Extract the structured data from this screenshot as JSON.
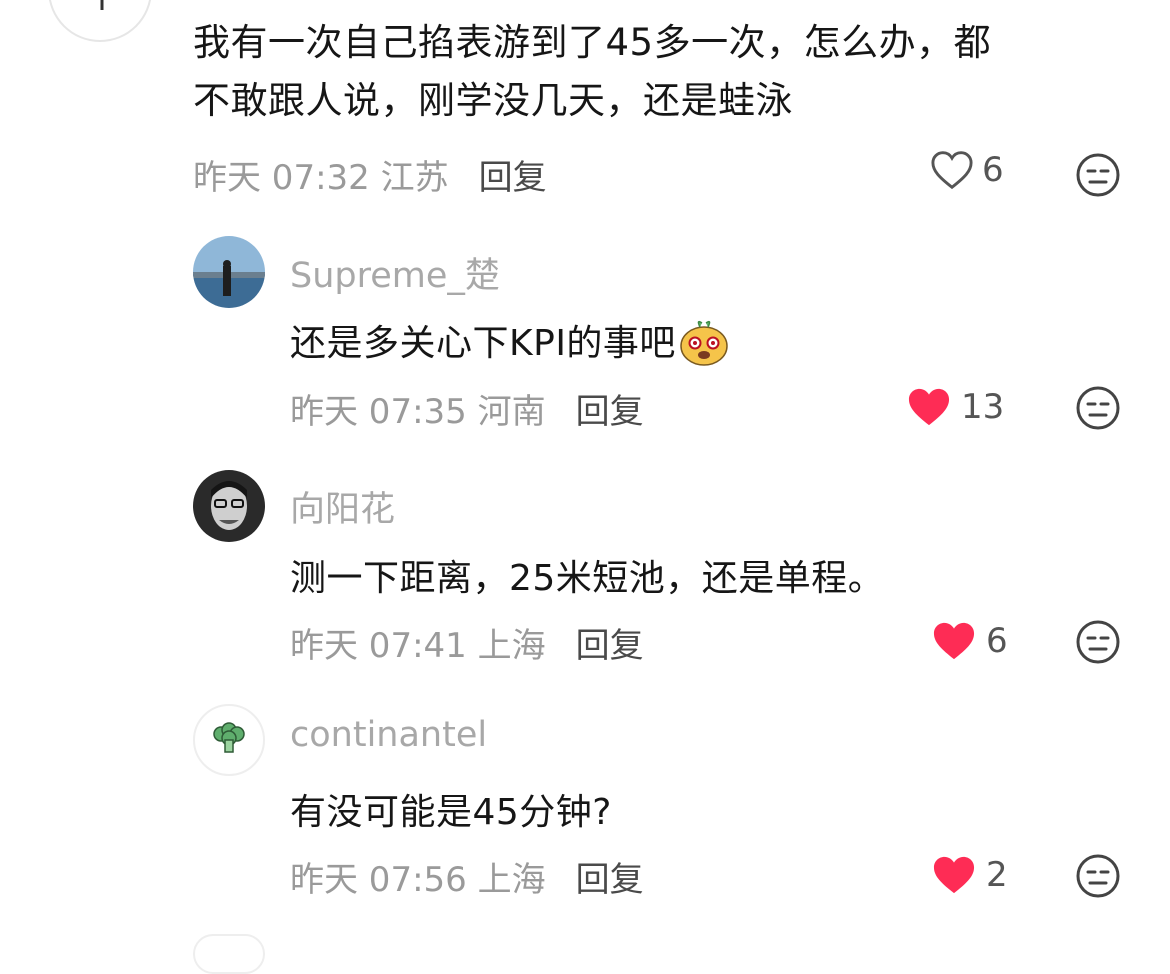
{
  "top_comment": {
    "text_line1": "我有一次自己掐表游到了45多一次，怎么办，都",
    "text_line2": "不敢跟人说，刚学没几天，还是蛙泳",
    "meta": "昨天 07:32 江苏",
    "reply_label": "回复",
    "likes": "6",
    "liked": false
  },
  "replies": [
    {
      "username": "Supreme_楚",
      "text": "还是多关心下KPI的事吧",
      "emoji_icon": "sheep-face-emoji",
      "meta": "昨天 07:35 河南",
      "reply_label": "回复",
      "likes": "13",
      "liked": true
    },
    {
      "username": "向阳花",
      "text": "测一下距离，25米短池，还是单程。",
      "meta": "昨天 07:41 上海",
      "reply_label": "回复",
      "likes": "6",
      "liked": true
    },
    {
      "username": "continantel",
      "text": "有没可能是45分钟?",
      "meta": "昨天 07:56 上海",
      "reply_label": "回复",
      "likes": "2",
      "liked": true
    }
  ],
  "colors": {
    "heart_liked": "#fe2c55",
    "meta_gray": "#9a9a9a",
    "username_gray": "#a8a8a8"
  }
}
